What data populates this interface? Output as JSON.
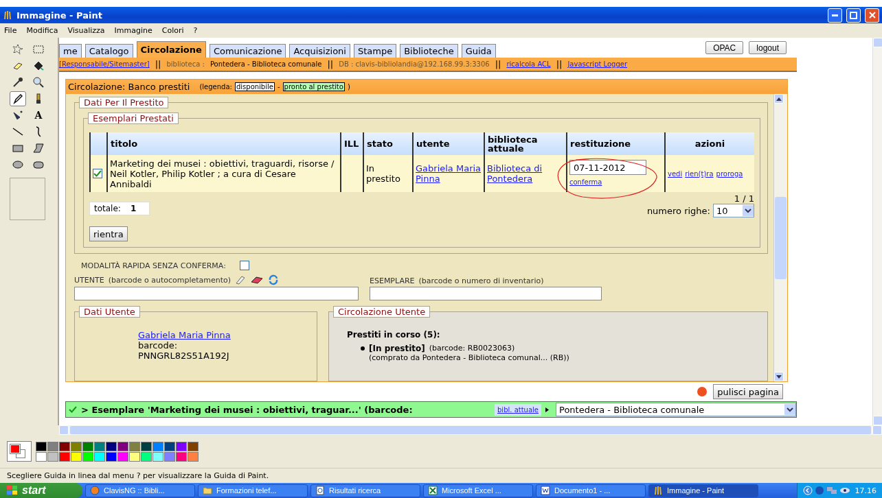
{
  "window": {
    "title": "Immagine - Paint"
  },
  "menu": [
    "File",
    "Modifica",
    "Visualizza",
    "Immagine",
    "Colori",
    "?"
  ],
  "tools": [
    {
      "kind": "free-select",
      "selected": false
    },
    {
      "kind": "rect-select",
      "selected": false
    },
    {
      "kind": "eraser",
      "selected": false
    },
    {
      "kind": "fill",
      "selected": false
    },
    {
      "kind": "picker",
      "selected": false
    },
    {
      "kind": "magnifier",
      "selected": false
    },
    {
      "kind": "pencil",
      "selected": true
    },
    {
      "kind": "brush",
      "selected": false
    },
    {
      "kind": "airbrush",
      "selected": false
    },
    {
      "kind": "text",
      "label": "A",
      "selected": false
    },
    {
      "kind": "line",
      "selected": false
    },
    {
      "kind": "curve",
      "selected": false
    },
    {
      "kind": "rectangle",
      "selected": false
    },
    {
      "kind": "polygon",
      "selected": false
    },
    {
      "kind": "ellipse",
      "selected": false
    },
    {
      "kind": "rounded",
      "selected": false
    }
  ],
  "page": {
    "tabs": [
      {
        "label": "me",
        "selected": false
      },
      {
        "label": "Catalogo",
        "selected": false
      },
      {
        "label": "Circolazione",
        "selected": true
      },
      {
        "label": "Comunicazione",
        "selected": false
      },
      {
        "label": "Acquisizioni",
        "selected": false
      },
      {
        "label": "Stampe",
        "selected": false
      },
      {
        "label": "Biblioteche",
        "selected": false
      },
      {
        "label": "Guida",
        "selected": false
      }
    ],
    "top_buttons": [
      "OPAC",
      "logout"
    ],
    "info_bar": [
      {
        "kind": "link",
        "text": "[Responsabile/Sitemaster]"
      },
      {
        "kind": "sep",
        "text": "||"
      },
      {
        "kind": "label",
        "text": "biblioteca :"
      },
      {
        "kind": "value",
        "text": "Pontedera - Biblioteca comunale"
      },
      {
        "kind": "sep",
        "text": "||"
      },
      {
        "kind": "label",
        "text": "DB : clavis-bibliolandia@192.168.99.3:3306"
      },
      {
        "kind": "sep",
        "text": "||"
      },
      {
        "kind": "link",
        "text": "ricalcola ACL"
      },
      {
        "kind": "sep",
        "text": "||"
      },
      {
        "kind": "link",
        "text": "Javascript Logger"
      }
    ],
    "panel": {
      "title": "Circolazione: Banco prestiti",
      "legend_open": "(legenda:",
      "legend": [
        {
          "text": "disponibile",
          "color": "#ffffff"
        },
        {
          "text": "pronto al prestito",
          "color": "#b4ffb4"
        }
      ],
      "legend_sep": "-",
      "legend_close": ")"
    },
    "loans": {
      "title": "Dati Per Il Prestito",
      "table_title": "Esemplari Prestati",
      "columns": [
        "titolo",
        "ILL",
        "stato",
        "utente",
        "biblioteca attuale",
        "restituzione",
        "azioni"
      ],
      "rows": [
        {
          "checked": true,
          "titolo": "Marketing dei musei : obiettivi, traguardi, risorse / Neil Kotler, Philip Kotler ; a cura di Cesare Annibaldi",
          "stato": "In prestito",
          "utente": "Gabriela Maria Pinna",
          "biblioteca": "Biblioteca di Pontedera",
          "restituzione": "07-11-2012",
          "confirm": "conferma",
          "actions": [
            "vedi",
            "rien(t)ra",
            "proroga"
          ]
        }
      ],
      "pager": "1 / 1",
      "rows_label": "numero righe:",
      "rows_value": "10",
      "total_label": "totale:",
      "total": "1",
      "return_button": "rientra"
    },
    "quick_mode": {
      "label": "MODALITÀ RAPIDA SENZA CONFERMA:",
      "checked": false
    },
    "user_field": {
      "label": "UTENTE",
      "hint": "(barcode o autocompletamento)"
    },
    "item_field": {
      "label": "ESEMPLARE",
      "hint": "(barcode o numero di inventario)"
    },
    "user_data": {
      "title": "Dati Utente",
      "name": "Gabriela Maria Pinna",
      "barcode_label": "barcode:",
      "barcode": "PNNGRL82S51A192J"
    },
    "user_circulation": {
      "title": "Circolazione Utente",
      "heading": "Prestiti in corso (5):",
      "items": [
        {
          "status": "[In prestito]",
          "barcode": "(barcode: RB0023063)",
          "source": "(comprato da Pontedera - Biblioteca comunal... (RB))"
        }
      ]
    },
    "clear_button": "pulisci pagina",
    "message": "> Esemplare 'Marketing dei musei : obiettivi, traguar...' (barcode:",
    "library_link": "bibl. attuale",
    "library_select": "Pontedera - Biblioteca comunale"
  },
  "palette": {
    "current": [
      {
        "color": "#ff0000"
      },
      {
        "color": "#ffffff"
      }
    ],
    "colors": [
      {
        "color": "#000000"
      },
      {
        "color": "#808080"
      },
      {
        "color": "#800000"
      },
      {
        "color": "#808000"
      },
      {
        "color": "#008000"
      },
      {
        "color": "#008080"
      },
      {
        "color": "#000080"
      },
      {
        "color": "#800080"
      },
      {
        "color": "#808040"
      },
      {
        "color": "#004040"
      },
      {
        "color": "#0080ff"
      },
      {
        "color": "#004080"
      },
      {
        "color": "#8000ff"
      },
      {
        "color": "#804000"
      },
      {
        "color": "#ffffff"
      },
      {
        "color": "#c0c0c0"
      },
      {
        "color": "#ff0000"
      },
      {
        "color": "#ffff00"
      },
      {
        "color": "#00ff00"
      },
      {
        "color": "#00ffff"
      },
      {
        "color": "#0000ff"
      },
      {
        "color": "#ff00ff"
      },
      {
        "color": "#ffff80"
      },
      {
        "color": "#00ff80"
      },
      {
        "color": "#80ffff"
      },
      {
        "color": "#8080ff"
      },
      {
        "color": "#ff0080"
      },
      {
        "color": "#ff8040"
      }
    ]
  },
  "status_bar": "Scegliere Guida in linea dal menu ? per visualizzare la Guida di Paint.",
  "taskbar": {
    "start": "start",
    "items": [
      {
        "kind": "browser",
        "label": "ClavisNG :: Bibli...",
        "selected": false
      },
      {
        "kind": "folder",
        "label": "Formazioni telef...",
        "selected": false
      },
      {
        "kind": "search",
        "label": "Risultati ricerca",
        "selected": false
      },
      {
        "kind": "excel",
        "label": "Microsoft Excel ...",
        "selected": false
      },
      {
        "kind": "word",
        "label": "Documento1 - ...",
        "selected": false
      },
      {
        "kind": "paint",
        "label": "Immagine - Paint",
        "selected": true
      }
    ],
    "clock": "17.16"
  }
}
